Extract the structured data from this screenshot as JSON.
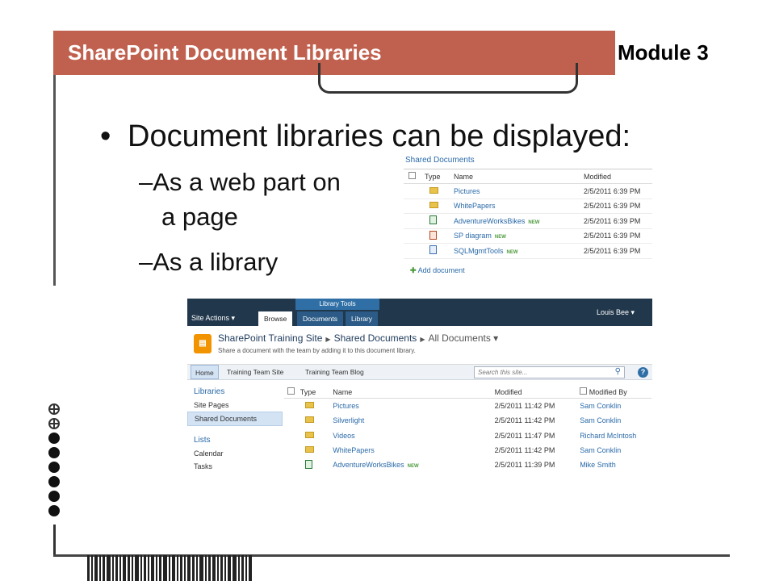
{
  "header": {
    "title": "SharePoint Document Libraries",
    "module": "Module 3",
    "header_color": "#c0614f"
  },
  "content": {
    "bullet": "Document libraries can be displayed:",
    "sub1_line1": "As a web part on",
    "sub1_line2": "a page",
    "sub2": "As a library"
  },
  "webpart": {
    "title": "Shared Documents",
    "col_type": "Type",
    "col_name": "Name",
    "col_modified": "Modified",
    "rows": [
      {
        "icon": "folder-icon",
        "name": "Pictures",
        "modified": "2/5/2011 6:39 PM",
        "new": ""
      },
      {
        "icon": "folder-icon",
        "name": "WhitePapers",
        "modified": "2/5/2011 6:39 PM",
        "new": ""
      },
      {
        "icon": "excel-icon",
        "name": "AdventureWorksBikes",
        "modified": "2/5/2011 6:39 PM",
        "new": "NEW"
      },
      {
        "icon": "visio-icon",
        "name": "SP diagram",
        "modified": "2/5/2011 6:39 PM",
        "new": "NEW"
      },
      {
        "icon": "word-icon",
        "name": "SQLMgmtTools",
        "modified": "2/5/2011 6:39 PM",
        "new": "NEW"
      }
    ],
    "add_document": "Add document"
  },
  "library": {
    "site_actions": "Site Actions ▾",
    "tools_label": "Library Tools",
    "tab_browse": "Browse",
    "tab_documents": "Documents",
    "tab_library": "Library",
    "user": "Louis Bee ▾",
    "crumb_site": "SharePoint Training Site",
    "crumb_lib": "Shared Documents",
    "crumb_view": "All Documents ▾",
    "description": "Share a document with the team by adding it to this document library.",
    "nav_home": "Home",
    "nav_training": "Training Team Site",
    "nav_blog": "Training Team Blog",
    "search_placeholder": "Search this site...",
    "quick_libraries": "Libraries",
    "quick_site_pages": "Site Pages",
    "quick_shared_docs": "Shared Documents",
    "quick_lists": "Lists",
    "quick_calendar": "Calendar",
    "quick_tasks": "Tasks",
    "col_type": "Type",
    "col_name": "Name",
    "col_modified": "Modified",
    "col_modified_by": "Modified By",
    "rows": [
      {
        "icon": "folder-icon",
        "name": "Pictures",
        "modified": "2/5/2011 11:42 PM",
        "by": "Sam Conklin",
        "new": ""
      },
      {
        "icon": "folder-icon",
        "name": "Silverlight",
        "modified": "2/5/2011 11:42 PM",
        "by": "Sam Conklin",
        "new": ""
      },
      {
        "icon": "folder-icon",
        "name": "Videos",
        "modified": "2/5/2011 11:47 PM",
        "by": "Richard McIntosh",
        "new": ""
      },
      {
        "icon": "folder-icon",
        "name": "WhitePapers",
        "modified": "2/5/2011 11:42 PM",
        "by": "Sam Conklin",
        "new": ""
      },
      {
        "icon": "excel-icon",
        "name": "AdventureWorksBikes",
        "modified": "2/5/2011 11:39 PM",
        "by": "Mike Smith",
        "new": "NEW"
      }
    ]
  }
}
